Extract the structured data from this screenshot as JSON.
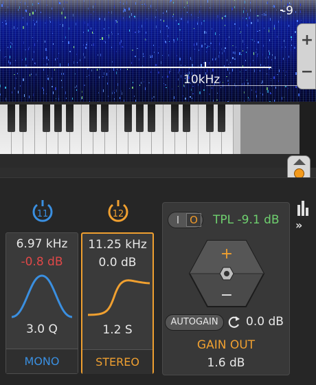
{
  "spectrogram": {
    "freq_label": "10kHz",
    "db_label": "-9",
    "zoom_in_icon": "plus-icon",
    "zoom_out_icon": "minus-icon",
    "zoom_in": "+",
    "zoom_out": "−"
  },
  "bands": [
    {
      "number": "11",
      "color": "#3a8fe0",
      "freq": "6.97 kHz",
      "gain": "-0.8 dB",
      "gain_color": "#e04848",
      "q": "3.0 Q",
      "mode": "MONO",
      "shape": "bell"
    },
    {
      "number": "12",
      "color": "#f0a030",
      "freq": "11.25 kHz",
      "gain": "0.0 dB",
      "gain_color": "#e8e8e8",
      "q": "1.2 S",
      "mode": "STEREO",
      "shape": "shelf",
      "selected": true
    }
  ],
  "output": {
    "toggle_i": "I",
    "toggle_o": "O",
    "tpl": "TPL -9.1 dB",
    "autogain": "AUTOGAIN",
    "reset_value": "0.0 dB",
    "gain_out_label": "GAIN OUT",
    "gain_out_value": "1.6 dB",
    "plus": "+",
    "minus": "−"
  },
  "side": {
    "expand": "»"
  }
}
